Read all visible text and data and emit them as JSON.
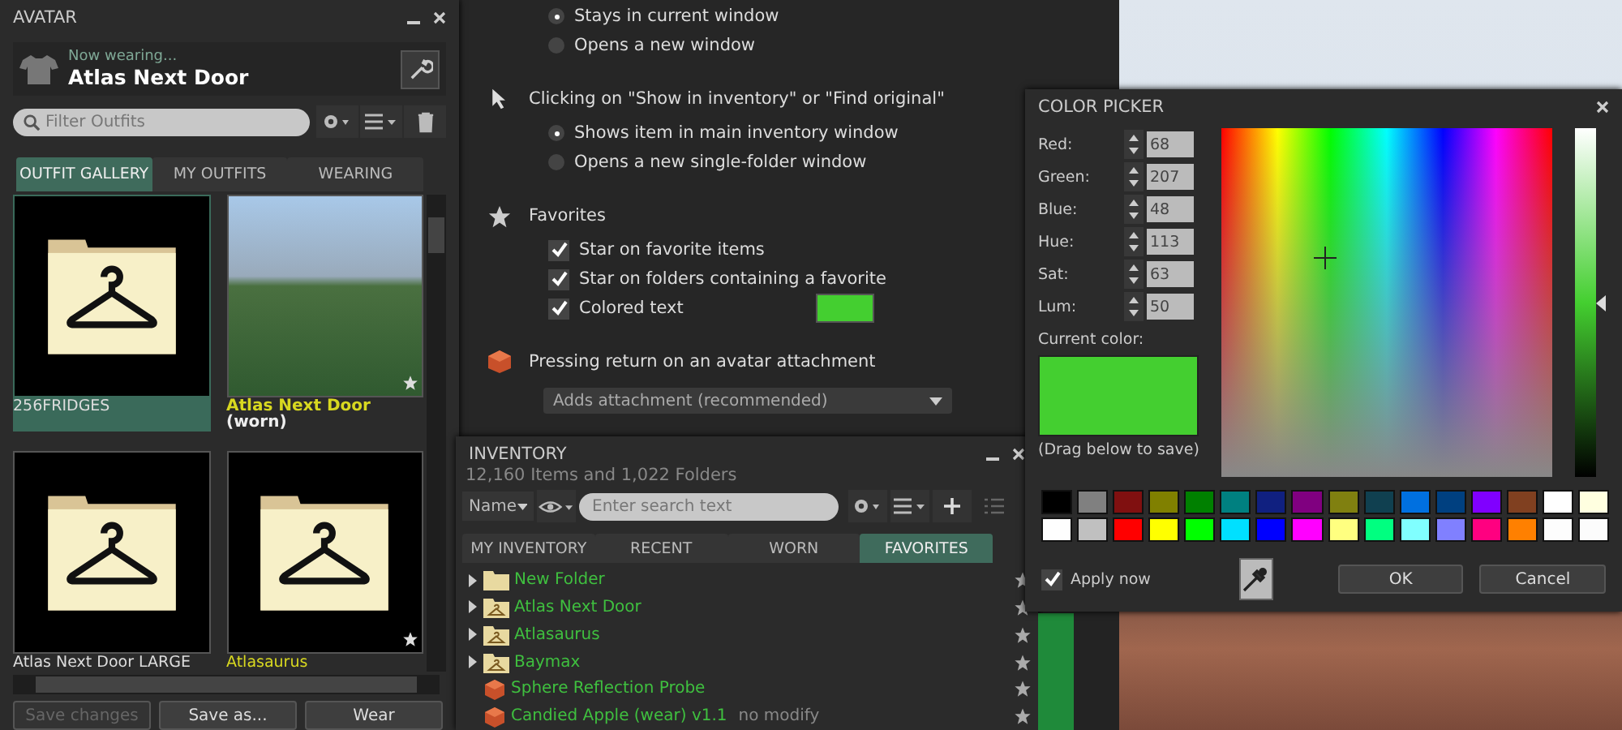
{
  "avatar_panel": {
    "title": "AVATAR",
    "now_wearing_label": "Now wearing...",
    "outfit_name": "Atlas Next Door",
    "filter": {
      "placeholder": "Filter Outfits"
    },
    "tabs": [
      {
        "label": "OUTFIT GALLERY",
        "selected": true
      },
      {
        "label": "MY OUTFITS",
        "selected": false
      },
      {
        "label": "WEARING",
        "selected": false
      }
    ],
    "outfits": [
      {
        "name": "256FRIDGES",
        "kind": "folder",
        "selected": true,
        "favorite": false
      },
      {
        "name": "Atlas Next Door",
        "worn_label": "(worn)",
        "kind": "photo",
        "selected": false,
        "favorite": true
      },
      {
        "name": "Atlas Next Door LARGE",
        "kind": "folder",
        "selected": false,
        "favorite": false
      },
      {
        "name": "Atlasaurus",
        "kind": "folder",
        "selected": false,
        "favorite": true
      }
    ],
    "buttons": [
      {
        "label": "Save changes",
        "disabled": true
      },
      {
        "label": "Save as...",
        "disabled": false
      },
      {
        "label": "Wear",
        "disabled": false
      }
    ]
  },
  "preferences": {
    "items": [
      {
        "kind": "radio",
        "label": "Stays in current window",
        "selected": true
      },
      {
        "kind": "radio",
        "label": "Opens a new window",
        "selected": false
      },
      {
        "kind": "heading",
        "label": "Clicking on \"Show in inventory\" or \"Find original\""
      },
      {
        "kind": "radio",
        "label": "Shows item in main inventory window",
        "selected": true
      },
      {
        "kind": "radio",
        "label": "Opens a new single-folder window",
        "selected": false
      },
      {
        "kind": "heading",
        "label": "Favorites"
      },
      {
        "kind": "checkbox",
        "label": "Star on favorite items",
        "checked": true
      },
      {
        "kind": "checkbox",
        "label": "Star on folders containing a favorite",
        "checked": true
      },
      {
        "kind": "color_checkbox",
        "label": "Colored text",
        "checked": true
      },
      {
        "kind": "heading",
        "label": "Pressing return on an avatar attachment"
      },
      {
        "kind": "dropdown",
        "value": "Adds attachment (recommended)"
      }
    ]
  },
  "inventory": {
    "title": "INVENTORY",
    "summary": "12,160 Items and 1,022 Folders",
    "sort": "Name",
    "search": {
      "placeholder": "Enter search text"
    },
    "tabs": [
      {
        "label": "MY INVENTORY",
        "selected": false
      },
      {
        "label": "RECENT",
        "selected": false
      },
      {
        "label": "WORN",
        "selected": false
      },
      {
        "label": "FAVORITES",
        "selected": true
      }
    ],
    "rows": [
      {
        "kind": "folder",
        "name": "New Folder",
        "expandable": true,
        "favorite": true
      },
      {
        "kind": "outfit",
        "name": "Atlas Next Door",
        "expandable": true,
        "favorite": true
      },
      {
        "kind": "outfit",
        "name": "Atlasaurus",
        "expandable": true,
        "favorite": true
      },
      {
        "kind": "outfit",
        "name": "Baymax",
        "expandable": true,
        "favorite": true
      },
      {
        "kind": "object",
        "name": "Sphere Reflection Probe",
        "expandable": false,
        "favorite": true
      },
      {
        "kind": "object",
        "name": "Candied Apple (wear) v1.1",
        "suffix": "no modify",
        "expandable": false,
        "favorite": true
      }
    ]
  },
  "color_picker": {
    "title": "COLOR PICKER",
    "fields": [
      {
        "label": "Red:",
        "value": "68"
      },
      {
        "label": "Green:",
        "value": "207"
      },
      {
        "label": "Blue:",
        "value": "48"
      },
      {
        "label": "Hue:",
        "value": "113"
      },
      {
        "label": "Sat:",
        "value": "63"
      },
      {
        "label": "Lum:",
        "value": "50"
      }
    ],
    "current_label": "Current color:",
    "drag_hint": "(Drag below to save)",
    "luminance": {
      "level": 0.5
    },
    "swatches": [
      {
        "color": "#000000"
      },
      {
        "color": "#808080"
      },
      {
        "color": "#801010"
      },
      {
        "color": "#808000"
      },
      {
        "color": "#008000"
      },
      {
        "color": "#008080"
      },
      {
        "color": "#102080"
      },
      {
        "color": "#800080"
      },
      {
        "color": "#808010"
      },
      {
        "color": "#104050"
      },
      {
        "color": "#0070e0"
      },
      {
        "color": "#004080"
      },
      {
        "color": "#8000ff"
      },
      {
        "color": "#804020"
      },
      {
        "color": "#ffffff"
      },
      {
        "color": "#ffffe0"
      },
      {
        "color": "#fefefe"
      },
      {
        "color": "#c0c0c0"
      },
      {
        "color": "#ff0000"
      },
      {
        "color": "#ffff00"
      },
      {
        "color": "#00ff00"
      },
      {
        "color": "#00e0ff"
      },
      {
        "color": "#0000ff"
      },
      {
        "color": "#ff00ff"
      },
      {
        "color": "#ffff80"
      },
      {
        "color": "#00ff80"
      },
      {
        "color": "#80ffff"
      },
      {
        "color": "#8080ff"
      },
      {
        "color": "#ff0080"
      },
      {
        "color": "#ff8000"
      },
      {
        "color": "#fdfdfd"
      },
      {
        "color": "#fcfcfc"
      }
    ],
    "apply_now": {
      "label": "Apply now",
      "checked": true
    },
    "buttons": [
      "OK",
      "Cancel"
    ]
  }
}
